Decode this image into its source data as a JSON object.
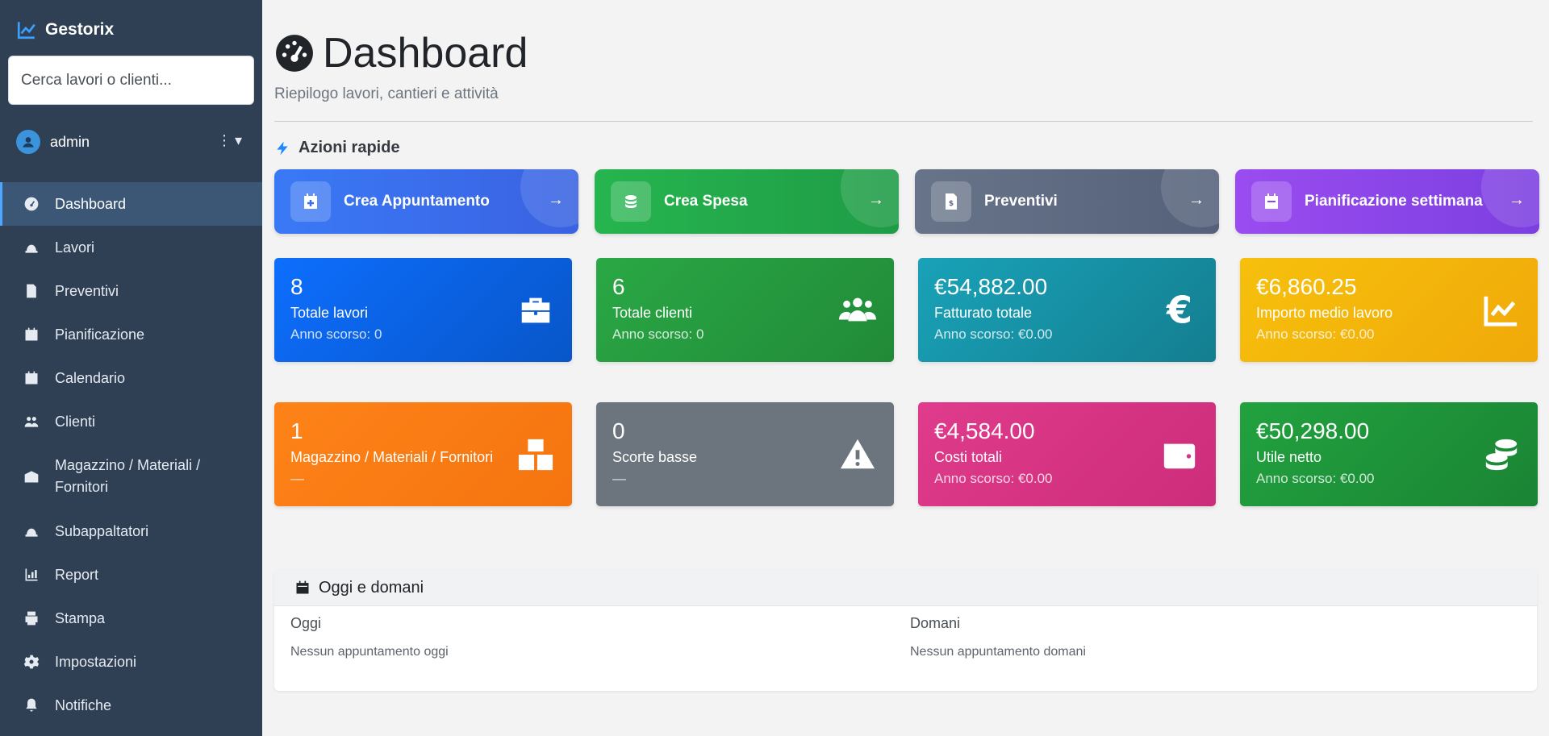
{
  "sidebar": {
    "brand": "Gestorix",
    "search_placeholder": "Cerca lavori o clienti...",
    "user": "admin",
    "items": [
      {
        "label": "Dashboard",
        "icon": "gauge-icon",
        "active": true
      },
      {
        "label": "Lavori",
        "icon": "hard-hat-icon"
      },
      {
        "label": "Preventivi",
        "icon": "invoice-icon"
      },
      {
        "label": "Pianificazione",
        "icon": "calendar-icon"
      },
      {
        "label": "Calendario",
        "icon": "calendar-icon"
      },
      {
        "label": "Clienti",
        "icon": "users-icon"
      },
      {
        "label": "Magazzino / Materiali / Fornitori",
        "icon": "warehouse-icon"
      },
      {
        "label": "Subappaltatori",
        "icon": "hard-hat-icon"
      },
      {
        "label": "Report",
        "icon": "chart-icon"
      },
      {
        "label": "Stampa",
        "icon": "printer-icon"
      },
      {
        "label": "Impostazioni",
        "icon": "gear-icon"
      },
      {
        "label": "Notifiche",
        "icon": "bell-icon"
      }
    ]
  },
  "header": {
    "title": "Dashboard",
    "subtitle": "Riepilogo lavori, cantieri e attività",
    "quick_actions_title": "Azioni rapide"
  },
  "quick_actions": [
    {
      "label": "Crea Appuntamento",
      "icon": "calendar-plus-icon",
      "color": "#3b6ef0"
    },
    {
      "label": "Crea Spesa",
      "icon": "coins-icon",
      "color": "#24b14f"
    },
    {
      "label": "Preventivi",
      "icon": "invoice-icon",
      "color": "#5e6b82"
    },
    {
      "label": "Pianificazione settimana",
      "icon": "calendar-icon",
      "color": "#8b45ea"
    }
  ],
  "stats": [
    {
      "value": "8",
      "label": "Totale lavori",
      "sub": "Anno scorso: 0",
      "icon": "briefcase-icon",
      "color": "#0d6efd"
    },
    {
      "value": "6",
      "label": "Totale clienti",
      "sub": "Anno scorso: 0",
      "icon": "users-icon",
      "color": "#28a745"
    },
    {
      "value": "€54,882.00",
      "label": "Fatturato totale",
      "sub": "Anno scorso: €0.00",
      "icon": "euro-icon",
      "color": "#17a2b8"
    },
    {
      "value": "€6,860.25",
      "label": "Importo medio lavoro",
      "sub": "Anno scorso: €0.00",
      "icon": "chart-line-icon",
      "color": "#f5be0b"
    },
    {
      "value": "1",
      "label": "Magazzino / Materiali / Fornitori",
      "sub": "—",
      "icon": "boxes-icon",
      "color": "#fd7e14"
    },
    {
      "value": "0",
      "label": "Scorte basse",
      "sub": "—",
      "icon": "warning-icon",
      "color": "#6c757d"
    },
    {
      "value": "€4,584.00",
      "label": "Costi totali",
      "sub": "Anno scorso: €0.00",
      "icon": "wallet-icon",
      "color": "#d63384"
    },
    {
      "value": "€50,298.00",
      "label": "Utile netto",
      "sub": "Anno scorso: €0.00",
      "icon": "coins-icon",
      "color": "#1f9a3c"
    }
  ],
  "today_panel": {
    "title": "Oggi e domani",
    "today_title": "Oggi",
    "today_text": "Nessun appuntamento oggi",
    "tomorrow_title": "Domani",
    "tomorrow_text": "Nessun appuntamento domani"
  }
}
